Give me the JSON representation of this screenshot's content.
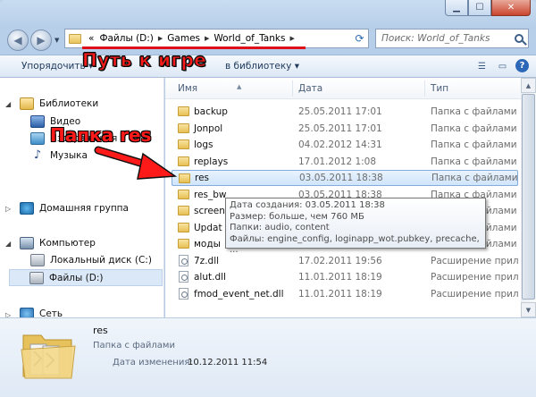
{
  "address": {
    "overflow": "«",
    "segments": [
      "Файлы (D:)",
      "Games",
      "World_of_Tanks"
    ]
  },
  "search": {
    "placeholder": "Поиск: World_of_Tanks"
  },
  "toolbar": {
    "organize": "Упорядочить",
    "organize_arrow": "▾",
    "library": "в библиотеку",
    "library_arrow": "▾",
    "help": "?"
  },
  "annotations": {
    "path": "Путь к игре",
    "folder": "Папка res"
  },
  "sidebar": {
    "libraries": "Библиотеки",
    "video": "Видео",
    "images": "Изображения",
    "music": "Музыка",
    "homegroup": "Домашняя группа",
    "computer": "Компьютер",
    "disk_c": "Локальный диск (C:)",
    "disk_d": "Файлы (D:)",
    "network": "Сеть"
  },
  "columns": {
    "name": "Имя",
    "date": "Дата",
    "type": "Тип"
  },
  "files": [
    {
      "name": "backup",
      "date": "25.05.2011 17:01",
      "type": "Папка с файлами",
      "kind": "folder"
    },
    {
      "name": "Jonpol",
      "date": "25.05.2011 17:01",
      "type": "Папка с файлами",
      "kind": "folder"
    },
    {
      "name": "logs",
      "date": "04.02.2012 14:31",
      "type": "Папка с файлами",
      "kind": "folder"
    },
    {
      "name": "replays",
      "date": "17.01.2012 1:08",
      "type": "Папка с файлами",
      "kind": "folder"
    },
    {
      "name": "res",
      "date": "03.05.2011 18:38",
      "type": "Папка с файлами",
      "kind": "folder",
      "selected": true
    },
    {
      "name": "res_bw",
      "date": "03.05.2011 18:38",
      "type": "Папка с файлами",
      "kind": "folder"
    },
    {
      "name": "screen",
      "date": "",
      "type": "Папка с файлами",
      "kind": "folder"
    },
    {
      "name": "Updat",
      "date": "",
      "type": "Папка с файлами",
      "kind": "folder"
    },
    {
      "name": "моды",
      "date": "",
      "type": "Папка с файлами",
      "kind": "folder"
    },
    {
      "name": "7z.dll",
      "date": "17.02.2011 19:56",
      "type": "Расширение прил",
      "kind": "dll"
    },
    {
      "name": "alut.dll",
      "date": "11.01.2011 18:19",
      "type": "Расширение прил",
      "kind": "dll"
    },
    {
      "name": "fmod_event_net.dll",
      "date": "11.01.2011 18:19",
      "type": "Расширение прил",
      "kind": "dll"
    }
  ],
  "tooltip": {
    "line1": "Дата создания: 03.05.2011 18:38",
    "line2": "Размер: больше, чем 760 МБ",
    "line3": "Папки: audio, content",
    "line4": "Файлы: engine_config, loginapp_wot.pubkey, precache, ..."
  },
  "details": {
    "name": "res",
    "type": "Папка с файлами",
    "date_label": "Дата изменения:",
    "date_value": "10.12.2011 11:54"
  },
  "colors": {
    "annotation": "#ff1a1a",
    "selection": "#cfe4fb"
  }
}
